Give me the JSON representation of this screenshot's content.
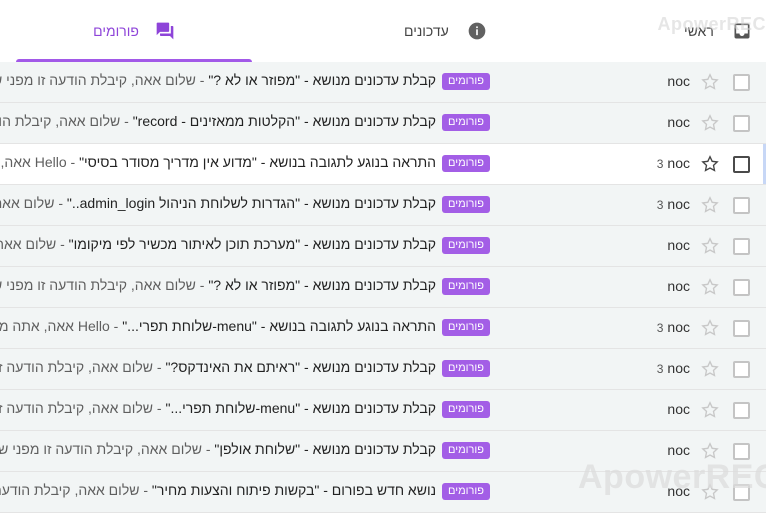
{
  "tabs": {
    "forums": "פורומים",
    "updates": "עדכונים",
    "main": "ראשי"
  },
  "watermark": "ApowerREC",
  "colors": {
    "accent": "#a259e8",
    "badge": "#a35ee6"
  },
  "rows": [
    {
      "sender": "noc",
      "count": "",
      "badge": "פורומים",
      "subject": "קבלת עדכונים מנושא - \"מפוזר או לא ?\"",
      "snippet": " - שלום אאה, קיבלת הודעה זו מפני שאתה"
    },
    {
      "sender": "noc",
      "count": "",
      "badge": "פורומים",
      "subject": "קבלת עדכונים מנושא - \"הקלטות ממאזינים - record\"",
      "snippet": " - שלום אאה, קיבלת הודעה זו"
    },
    {
      "sender": "noc",
      "count": "3",
      "badge": "פורומים",
      "subject": "התראה בנוגע לתגובה בנושא - \"מדוע אין מדריך מסודר בסיסי\"",
      "snippet": " - Hello אאה, אתה מקבל"
    },
    {
      "sender": "noc",
      "count": "3",
      "badge": "פורומים",
      "subject": "קבלת עדכונים מנושא - \"הגדרות לשלוחת הניהול admin_login..\"",
      "snippet": " - שלום אאה, קיבלת"
    },
    {
      "sender": "noc",
      "count": "",
      "badge": "פורומים",
      "subject": "קבלת עדכונים מנושא - \"מערכת תוכן לאיתור מכשיר לפי מיקומו\"",
      "snippet": " - שלום אאה, קיבלת"
    },
    {
      "sender": "noc",
      "count": "",
      "badge": "פורומים",
      "subject": "קבלת עדכונים מנושא - \"מפוזר או לא ?\"",
      "snippet": " - שלום אאה, קיבלת הודעה זו מפני שאתה"
    },
    {
      "sender": "noc",
      "count": "3",
      "badge": "פורומים",
      "subject": "התראה בנוגע לתגובה בנושא - \"menu-שלוחת תפרי...\"",
      "snippet": " - Hello אאה, אתה מקבל"
    },
    {
      "sender": "noc",
      "count": "3",
      "badge": "פורומים",
      "subject": "קבלת עדכונים מנושא - \"ראיתם את האינדקס?\"",
      "snippet": " - שלום אאה, קיבלת הודעה זו מפני"
    },
    {
      "sender": "noc",
      "count": "",
      "badge": "פורומים",
      "subject": "קבלת עדכונים מנושא - \"menu-שלוחת תפרי...\"",
      "snippet": " - שלום אאה, קיבלת הודעה זו מפני"
    },
    {
      "sender": "noc",
      "count": "",
      "badge": "פורומים",
      "subject": "קבלת עדכונים מנושא - \"שלוחת אולפן\"",
      "snippet": " - שלום אאה, קיבלת הודעה זו מפני שאתה"
    },
    {
      "sender": "noc",
      "count": "",
      "badge": "פורומים",
      "subject": "נושא חדש בפורום - \"בקשות פיתוח והצעות מחיר\"",
      "snippet": " - שלום אאה, קיבלת הודעה זו מפני שאתה"
    }
  ],
  "hover_row": 2
}
